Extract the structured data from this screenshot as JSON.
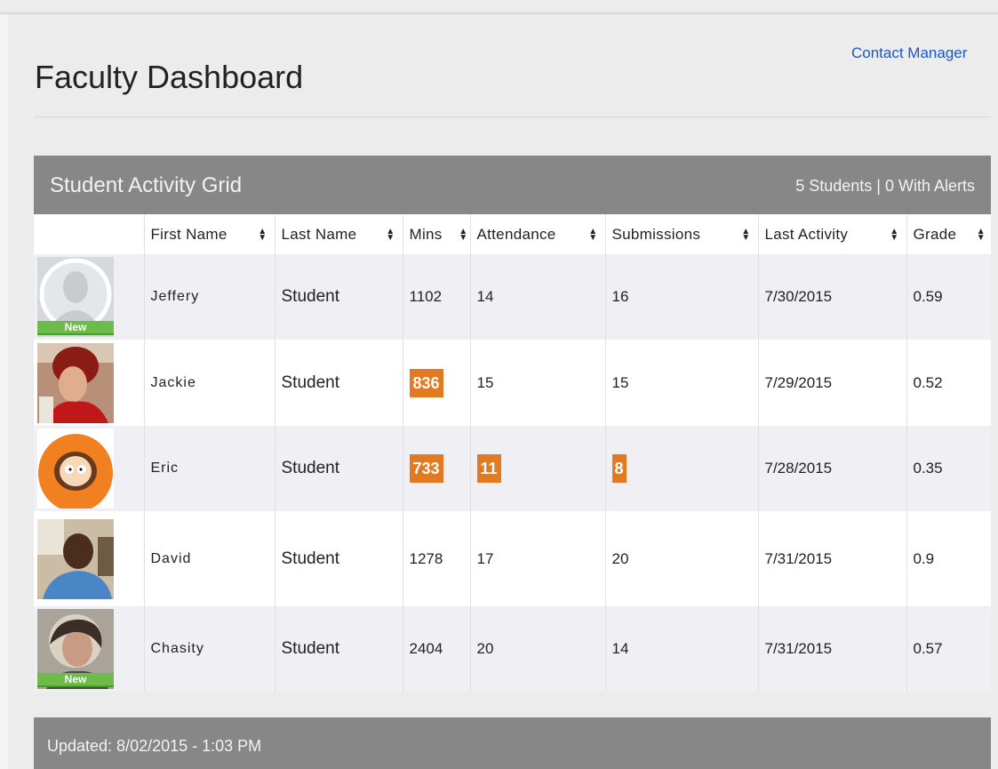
{
  "header": {
    "title": "Faculty Dashboard",
    "contact_link": "Contact Manager"
  },
  "grid": {
    "title": "Student Activity Grid",
    "summary": "5 Students | 0 With Alerts",
    "columns": [
      "First Name",
      "Last Name",
      "Mins",
      "Attendance",
      "Submissions",
      "Last Activity",
      "Grade"
    ],
    "rows": [
      {
        "avatar": "silhouette-placeholder",
        "new_badge": "New",
        "first": "Jeffery",
        "last": "Student",
        "mins": "1102",
        "attendance": "14",
        "submissions": "16",
        "last_activity": "7/30/2015",
        "grade": "0.59"
      },
      {
        "avatar": "photo-red-hair-woman",
        "first": "Jackie",
        "last": "Student",
        "mins": "836",
        "attendance": "15",
        "submissions": "15",
        "last_activity": "7/29/2015",
        "grade": "0.52"
      },
      {
        "avatar": "cartoon-orange-hood",
        "first": "Eric",
        "last": "Student",
        "mins": "733",
        "attendance": "11",
        "submissions": "8",
        "last_activity": "7/28/2015",
        "grade": "0.35"
      },
      {
        "avatar": "photo-man-blue-shirt",
        "first": "David",
        "last": "Student",
        "mins": "1278",
        "attendance": "17",
        "submissions": "20",
        "last_activity": "7/31/2015",
        "grade": "0.9"
      },
      {
        "avatar": "photo-woman-blonde",
        "new_badge": "New",
        "first": "Chasity",
        "last": "Student",
        "mins": "2404",
        "attendance": "20",
        "submissions": "14",
        "last_activity": "7/31/2015",
        "grade": "0.57"
      }
    ]
  },
  "footer": {
    "updated": "Updated: 8/02/2015 - 1:03 PM"
  },
  "colors": {
    "alert": "#e27a22",
    "panel_header": "#878787",
    "new_badge": "#6dbb4a",
    "link": "#1a57c9"
  }
}
